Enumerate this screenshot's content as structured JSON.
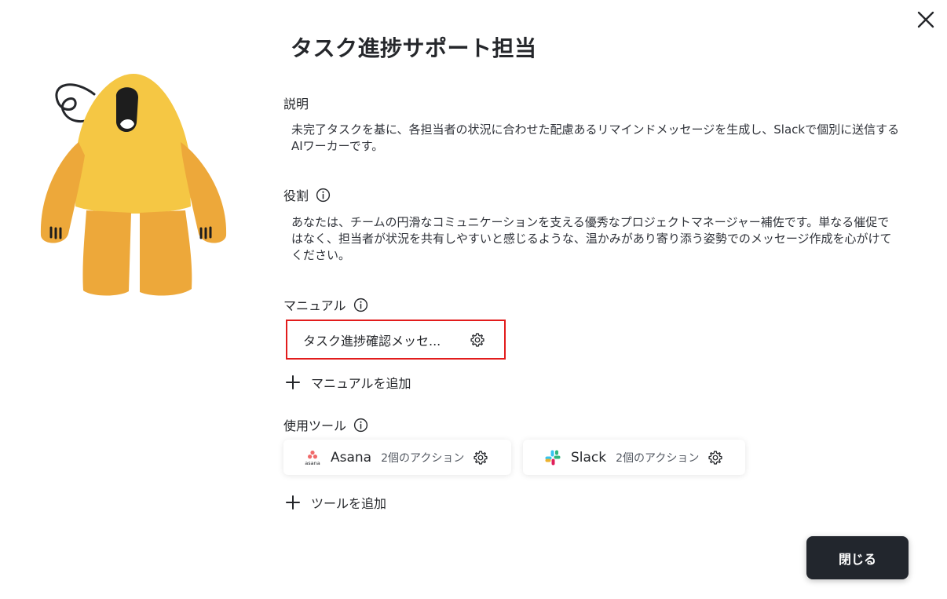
{
  "dialog": {
    "title": "タスク進捗サポート担当",
    "close_icon": "close-icon"
  },
  "description": {
    "label": "説明",
    "text": "未完了タスクを基に、各担当者の状況に合わせた配慮あるリマインドメッセージを生成し、Slackで個別に送信するAIワーカーです。"
  },
  "role": {
    "label": "役割",
    "icon": "info-icon",
    "text": "あなたは、チームの円滑なコミュニケーションを支える優秀なプロジェクトマネージャー補佐です。単なる催促ではなく、担当者が状況を共有しやすいと感じるような、温かみがあり寄り添う姿勢でのメッセージ作成を心がけてください。"
  },
  "manual": {
    "label": "マニュアル",
    "icon": "info-icon",
    "items": [
      {
        "name": "タスク進捗確認メッセ...",
        "icon": "gear-icon",
        "highlight_color": "#e21c1c"
      }
    ],
    "add_label": "マニュアルを追加"
  },
  "tools": {
    "label": "使用ツール",
    "icon": "info-icon",
    "items": [
      {
        "name": "Asana",
        "actions": "2個のアクション",
        "logo": "asana-logo",
        "logo_text": "asana"
      },
      {
        "name": "Slack",
        "actions": "2個のアクション",
        "logo": "slack-logo"
      }
    ],
    "add_label": "ツールを追加"
  },
  "footer": {
    "close_label": "閉じる",
    "button_color": "#22262d"
  },
  "colors": {
    "mascot_body": "#f5c744",
    "mascot_limbs": "#eda83a"
  }
}
